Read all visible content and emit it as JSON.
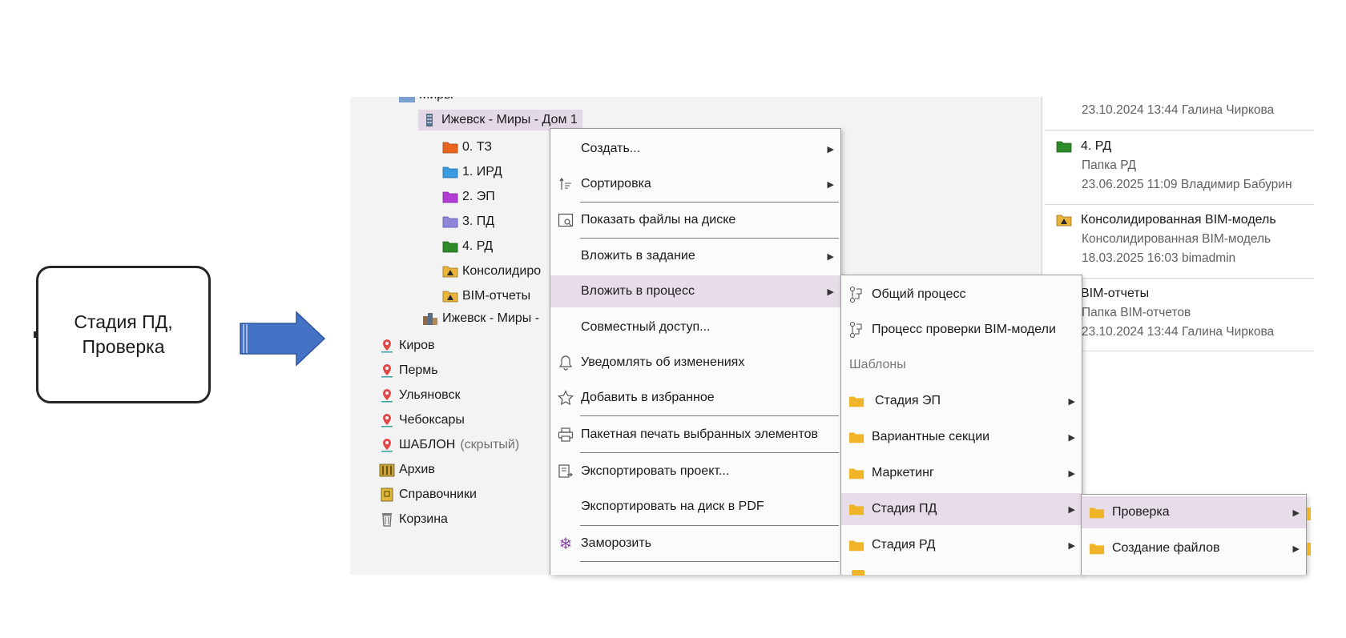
{
  "diagram": {
    "stage_text_line1": "Стадия ПД,",
    "stage_text_line2": "Проверка",
    "arrow_color": "#4472c4"
  },
  "tree": {
    "partial_top": "Миры",
    "selected": "Ижевск - Миры - Дом 1",
    "children": [
      {
        "label": "0. ТЗ",
        "color": "#e8641e"
      },
      {
        "label": "1. ИРД",
        "color": "#3a9be0"
      },
      {
        "label": "2. ЭП",
        "color": "#b43cd6"
      },
      {
        "label": "3. ПД",
        "color": "#8e86d8"
      },
      {
        "label": "4. РД",
        "color": "#2d8a28"
      },
      {
        "label": "Консолидиро",
        "color": "#e8b43c"
      },
      {
        "label": "BIM-отчеты",
        "color": "#e8b43c"
      }
    ],
    "sibling": "Ижевск - Миры -",
    "cities": [
      "Киров",
      "Пермь",
      "Ульяновск",
      "Чебоксары"
    ],
    "template": "ШАБЛОН",
    "template_note": "(скрытый)",
    "archive": "Архив",
    "references": "Справочники",
    "trash": "Корзина"
  },
  "details": {
    "top_meta": "23.10.2024 13:44 Галина Чиркова",
    "items": [
      {
        "title": "4. РД",
        "subtitle": "Папка РД",
        "meta": "23.06.2025 11:09 Владимир Бабурин"
      },
      {
        "title": "Консолидированная BIM-модель",
        "subtitle": "Консолидированная BIM-модель",
        "meta": "18.03.2025 16:03 bimadmin"
      },
      {
        "title": "BIM-отчеты",
        "subtitle": "Папка BIM-отчетов",
        "meta": "23.10.2024 13:44 Галина Чиркова"
      }
    ]
  },
  "context_menu": {
    "items": {
      "create": "Создать...",
      "sort": "Сортировка",
      "show_files": "Показать файлы на диске",
      "attach_task": "Вложить в задание",
      "attach_process": "Вложить в процесс",
      "share": "Совместный доступ...",
      "notify": "Уведомлять об изменениях",
      "favorite": "Добавить в избранное",
      "batch_print": "Пакетная печать выбранных элементов",
      "export_project": "Экспортировать проект...",
      "export_pdf": "Экспортировать на диск в PDF",
      "freeze": "Заморозить"
    }
  },
  "process_menu": {
    "general": "Общий процесс",
    "bim_check": "Процесс проверки BIM-модели",
    "templates_label": "Шаблоны",
    "templates": [
      "Стадия ЭП",
      "Вариантные секции",
      "Маркетинг",
      "Стадия ПД",
      "Стадия РД"
    ]
  },
  "stage_menu": {
    "items": [
      "Проверка",
      "Создание файлов"
    ]
  }
}
